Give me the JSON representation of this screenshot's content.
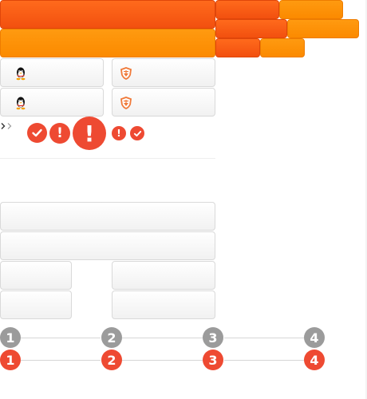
{
  "steps": {
    "row1": [
      "1",
      "2",
      "3",
      "4"
    ],
    "row2": [
      "1",
      "2",
      "3",
      "4"
    ]
  },
  "badges": {
    "exclaim": "!"
  },
  "icons": {
    "qq": "qq-penguin-icon",
    "shield": "shield-logo-icon",
    "check": "check-icon",
    "exclaim": "exclamation-icon",
    "chevron": "chevron-right-icon"
  },
  "colors": {
    "accent_red": "#ee4a32",
    "accent_orange": "#fb8a00",
    "step_grey": "#9b9b9b"
  }
}
